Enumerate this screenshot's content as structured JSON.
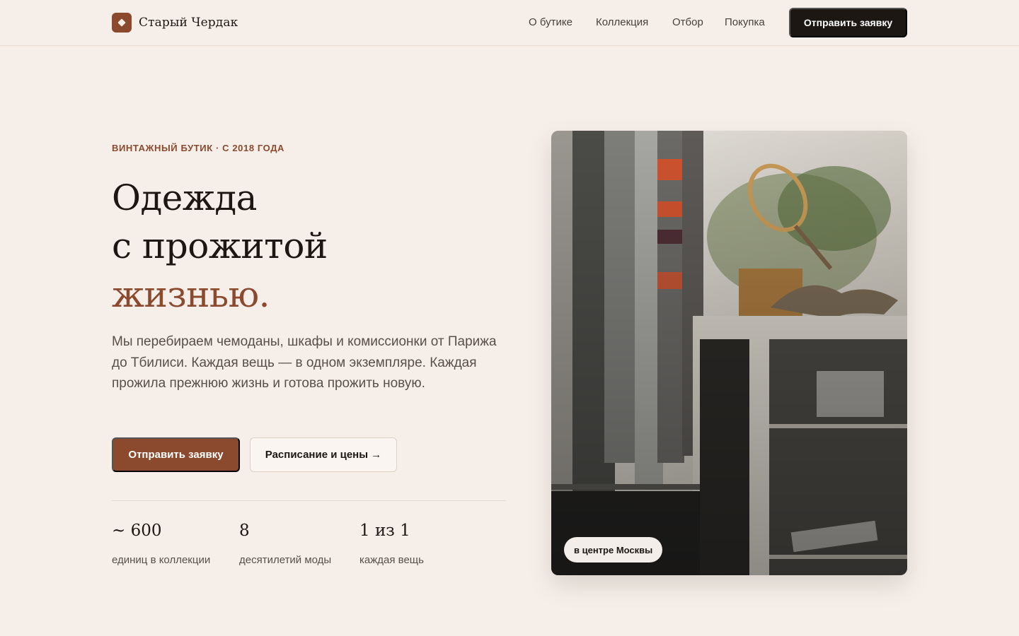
{
  "header": {
    "brand": "Старый Чердак",
    "nav": [
      "О бутике",
      "Коллекция",
      "Отбор",
      "Покупка"
    ],
    "cta": "Отправить заявку"
  },
  "hero": {
    "eyebrow": "ВИНТАЖНЫЙ БУТИК · С 2018 ГОДА",
    "title_lines": [
      "Одежда",
      "с прожитой",
      "жизнью."
    ],
    "lead": "Мы перебираем чемоданы, шкафы и комиссионки от Парижа до Тбилиси. Каждая вещь — в одном экземпляре. Каждая прожила прежнюю жизнь и готова прожить новую.",
    "primary_button": "Отправить заявку",
    "secondary_button": "Расписание и цены →",
    "stats": [
      {
        "value": "~ 600",
        "label": "единиц в коллекции"
      },
      {
        "value": "8",
        "label": "десятилетий моды"
      },
      {
        "value": "1 из 1",
        "label": "каждая вещь"
      }
    ],
    "photo_badge": "в центре Москвы"
  },
  "colors": {
    "background": "#f6efe9",
    "accent": "#8b4a2e",
    "dark": "#1d1714"
  }
}
